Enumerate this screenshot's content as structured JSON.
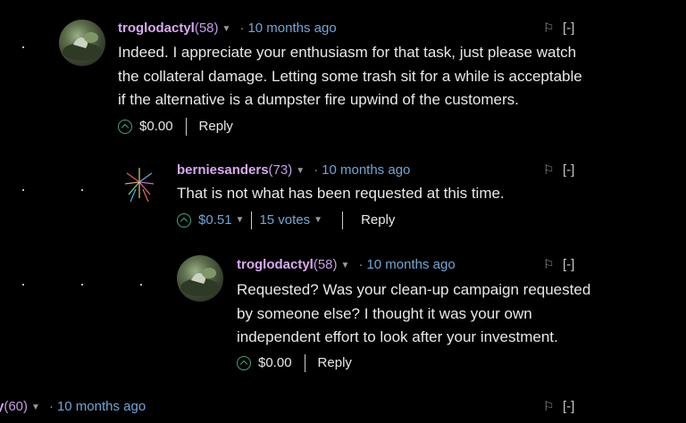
{
  "comments": [
    {
      "author": "troglodactyl",
      "reputation": "(58)",
      "time": "10 months ago",
      "collapse": "[-]",
      "body": [
        "Indeed. I appreciate your enthusiasm for that task, just please watch",
        "the collateral damage. Letting some trash sit for a while is acceptable",
        "if the alternative is a dumpster fire upwind of the customers."
      ],
      "payout": "$0.00",
      "reply": "Reply"
    },
    {
      "author": "berniesanders",
      "reputation": "(73)",
      "time": "10 months ago",
      "collapse": "[-]",
      "body": [
        "That is not what has been requested at this time."
      ],
      "payout": "$0.51",
      "votes": "15 votes",
      "reply": "Reply"
    },
    {
      "author": "troglodactyl",
      "reputation": "(58)",
      "time": "10 months ago",
      "collapse": "[-]",
      "body": [
        "Requested? Was your clean-up campaign requested",
        "by someone else? I thought it was your own",
        "independent effort to look after your investment."
      ],
      "payout": "$0.00",
      "reply": "Reply"
    },
    {
      "reputation": "(60)",
      "time": "10 months ago",
      "collapse": "[-]"
    }
  ],
  "colors": {
    "background": "#000000",
    "author": "#d9a9f2",
    "link": "#6fa6d6",
    "upvote": "#3fa87a"
  }
}
